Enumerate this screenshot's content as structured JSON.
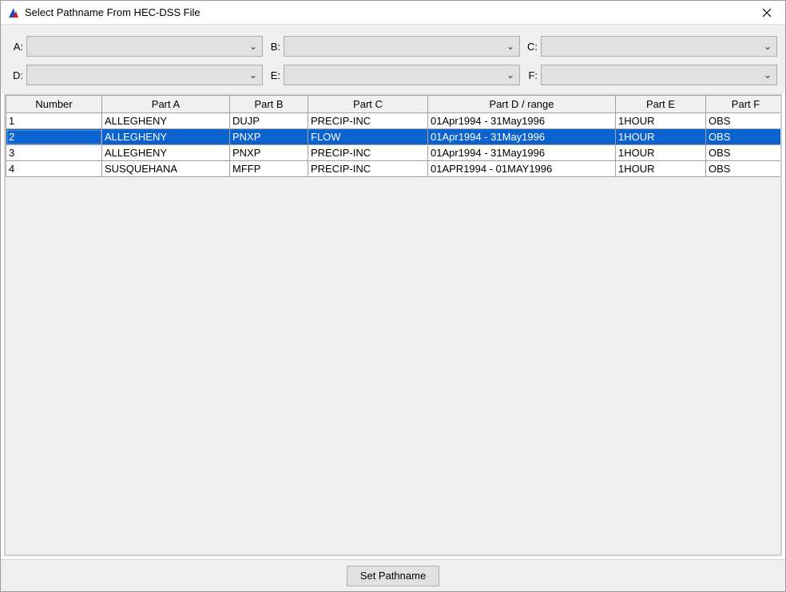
{
  "window": {
    "title": "Select Pathname From HEC-DSS File"
  },
  "filters": {
    "a": {
      "label": "A:"
    },
    "b": {
      "label": "B:"
    },
    "c": {
      "label": "C:"
    },
    "d": {
      "label": "D:"
    },
    "e": {
      "label": "E:"
    },
    "f": {
      "label": "F:"
    }
  },
  "table": {
    "headers": {
      "number": "Number",
      "part_a": "Part A",
      "part_b": "Part B",
      "part_c": "Part C",
      "part_d": "Part D / range",
      "part_e": "Part E",
      "part_f": "Part F"
    },
    "rows": [
      {
        "number": "1",
        "a": "ALLEGHENY",
        "b": "DUJP",
        "c": "PRECIP-INC",
        "d": "01Apr1994 - 31May1996",
        "e": "1HOUR",
        "f": "OBS",
        "selected": false
      },
      {
        "number": "2",
        "a": "ALLEGHENY",
        "b": "PNXP",
        "c": "FLOW",
        "d": "01Apr1994 - 31May1996",
        "e": "1HOUR",
        "f": "OBS",
        "selected": true
      },
      {
        "number": "3",
        "a": "ALLEGHENY",
        "b": "PNXP",
        "c": "PRECIP-INC",
        "d": "01Apr1994 - 31May1996",
        "e": "1HOUR",
        "f": "OBS",
        "selected": false
      },
      {
        "number": "4",
        "a": "SUSQUEHANA",
        "b": "MFFP",
        "c": "PRECIP-INC",
        "d": "01APR1994 - 01MAY1996",
        "e": "1HOUR",
        "f": "OBS",
        "selected": false
      }
    ]
  },
  "buttons": {
    "set_pathname": "Set Pathname"
  }
}
